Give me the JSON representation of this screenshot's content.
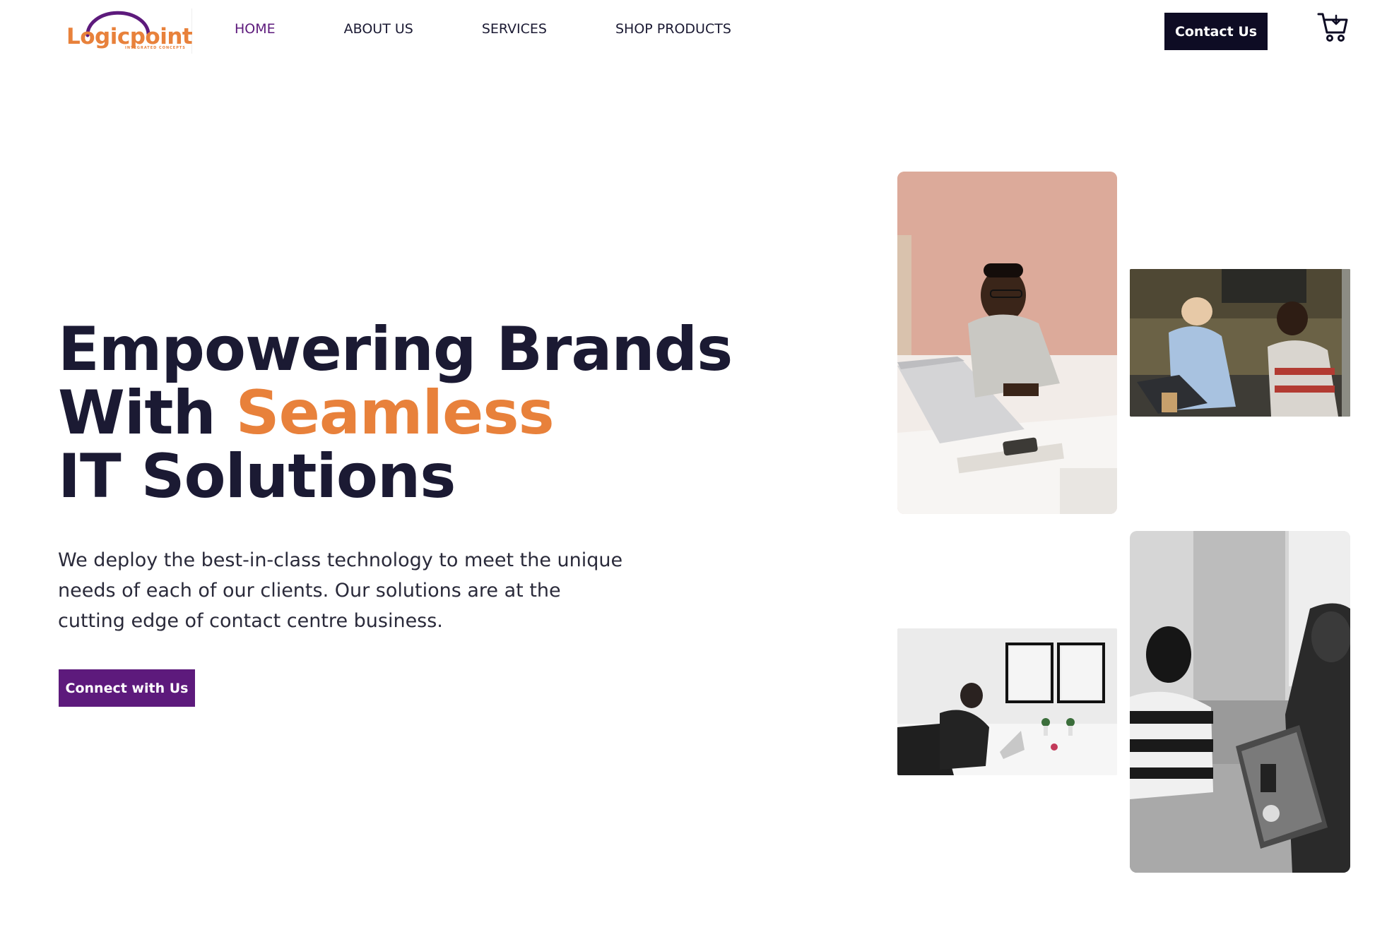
{
  "brand": {
    "name": "Logicpoint",
    "tagline": "INTEGRATED CONCEPTS",
    "colors": {
      "primary": "#5d1a7c",
      "accent": "#e8813b",
      "dark": "#0e0c24",
      "text": "#1b1a33"
    }
  },
  "nav": {
    "items": [
      {
        "label": "HOME",
        "active": true
      },
      {
        "label": "ABOUT US",
        "active": false
      },
      {
        "label": "SERVICES",
        "active": false
      },
      {
        "label": "SHOP PRODUCTS",
        "active": false
      }
    ],
    "contact_label": "Contact Us",
    "cart_icon": "cart-icon"
  },
  "hero": {
    "title_line1": "Empowering Brands",
    "title_line2_prefix": "With ",
    "title_line2_accent": "Seamless",
    "title_line3": "IT Solutions",
    "description_lines": [
      "We deploy the best-in-class technology to meet the unique",
      "needs of each of our clients. Our solutions are at the",
      "cutting edge of contact centre business."
    ],
    "cta_label": "Connect with Us"
  },
  "gallery": {
    "images": [
      {
        "name": "man-with-laptop-photo"
      },
      {
        "name": "call-center-agents-photo"
      },
      {
        "name": "man-at-desk-photo"
      },
      {
        "name": "women-with-laptop-photo"
      }
    ]
  }
}
